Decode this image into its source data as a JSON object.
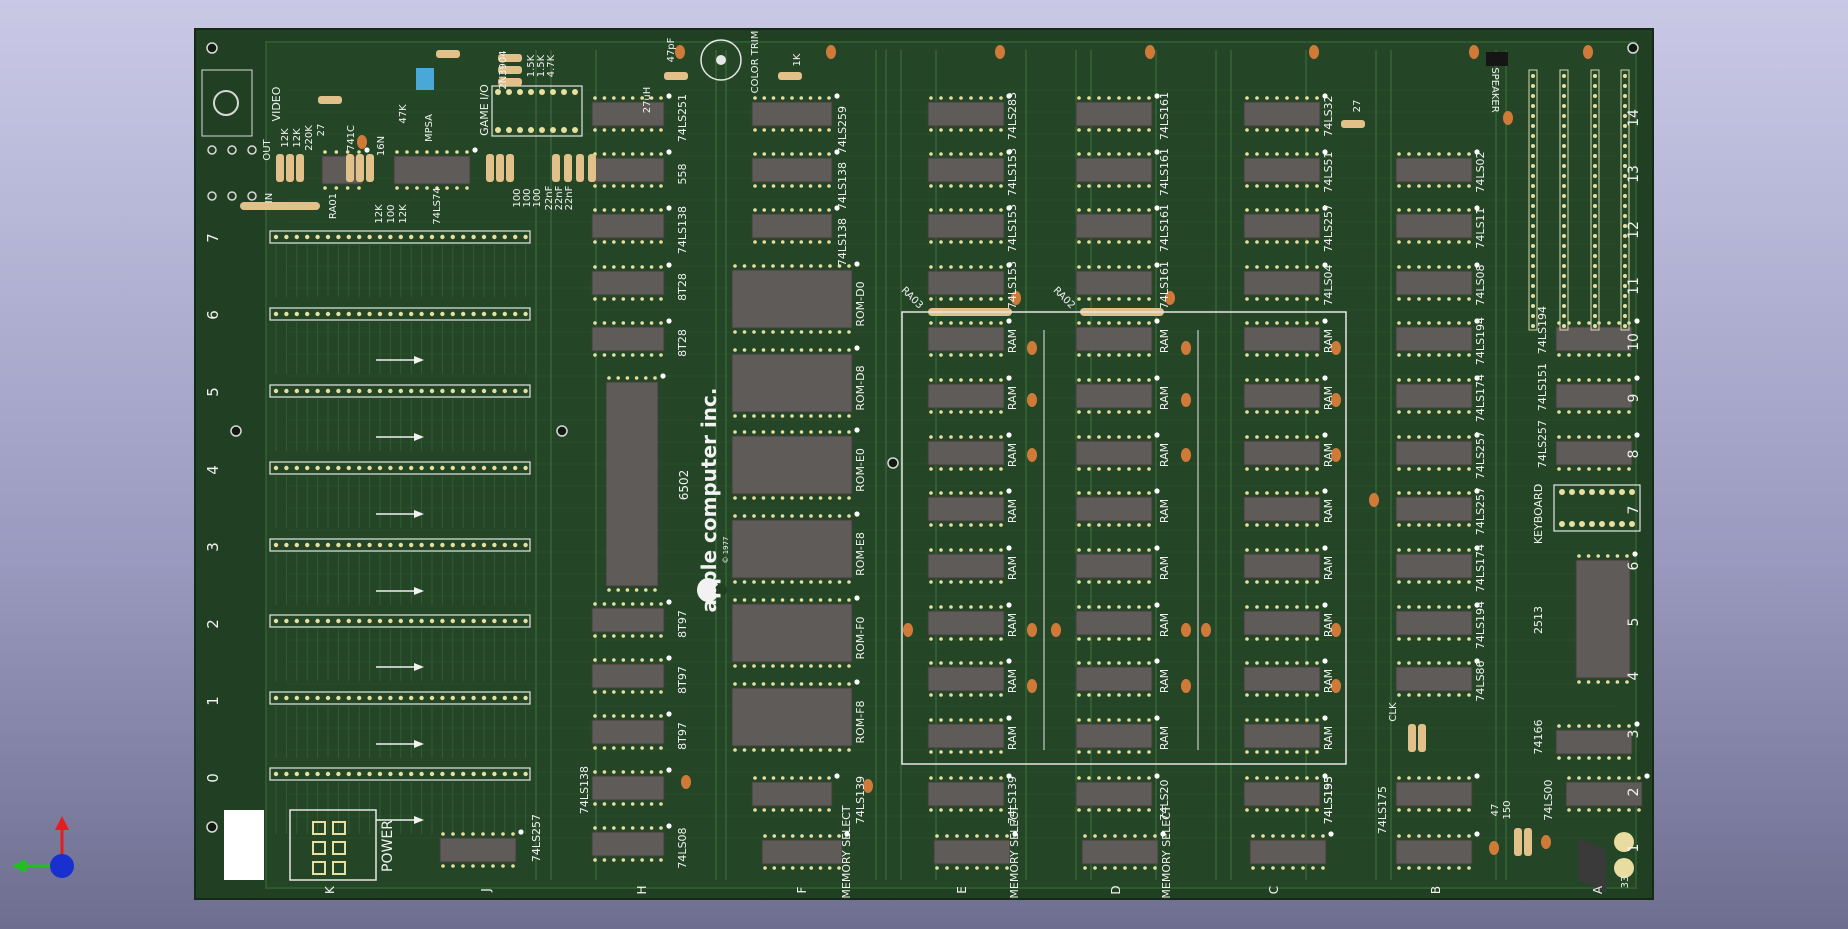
{
  "board": {
    "colors": {
      "substrate": "#213f23",
      "copper": "#2f5a30",
      "trace": "#3d6c3c",
      "chip": "#5f5b58",
      "pad": "#e8e0a0",
      "silk": "#f2f2f2",
      "cap": "#d07a3a",
      "resistor": "#e2c08a"
    },
    "brand": {
      "name": "apple computer inc.",
      "year": "© 1977"
    },
    "cpu_label": "6502",
    "rows": [
      "A",
      "B",
      "C",
      "D",
      "E",
      "F",
      "H",
      "J",
      "K"
    ],
    "slots": [
      "0",
      "1",
      "2",
      "3",
      "4",
      "5",
      "6",
      "7"
    ],
    "edge_numbers": [
      "1",
      "2",
      "3",
      "4",
      "5",
      "6",
      "7",
      "8",
      "9",
      "10",
      "11",
      "12",
      "13",
      "14"
    ],
    "connectors": {
      "video": "VIDEO",
      "out": "OUT",
      "in": "IN",
      "power": "POWER",
      "speaker": "SPEAKER",
      "keyboard": "KEYBOARD",
      "game_io": "GAME I/O",
      "color_trim": "COLOR TRIM"
    },
    "top_labels": [
      "12K",
      "12K",
      "220K",
      "27",
      "741C",
      "47K",
      "16N",
      "2N3904",
      "1.5K",
      "1.5K",
      "4.7K",
      "27uH",
      "47pF",
      "1K",
      "27",
      "MPSA",
      "RA01"
    ],
    "misc_labels": [
      "12K",
      "100",
      "12K",
      "74LS74",
      "100",
      "100",
      "100",
      "22nF",
      "22nF",
      "22nF",
      "RA03",
      "RA02",
      "47",
      "150",
      "CLK"
    ],
    "col_h": [
      "74LS251",
      "558",
      "74LS138",
      "8T28",
      "8T28",
      "8T97",
      "8T97",
      "8T97",
      "74LS138",
      "74LS08"
    ],
    "col_f": [
      "74LS259",
      "74LS138",
      "74LS138",
      "ROM-D0",
      "ROM-D8",
      "ROM-E0",
      "ROM-E8",
      "ROM-F0",
      "ROM-F8",
      "74LS139"
    ],
    "col_e": [
      "74LS283",
      "74LS153",
      "74LS153",
      "74LS153",
      "RAM",
      "RAM",
      "RAM",
      "RAM",
      "RAM",
      "RAM",
      "RAM",
      "RAM",
      "74LS139"
    ],
    "col_d": [
      "74LS161",
      "74LS161",
      "74LS161",
      "74LS161",
      "RAM",
      "RAM",
      "RAM",
      "RAM",
      "RAM",
      "RAM",
      "RAM",
      "RAM",
      "74LS20"
    ],
    "col_c": [
      "74LS32",
      "74LS51",
      "74LS257",
      "74LS04",
      "RAM",
      "RAM",
      "RAM",
      "RAM",
      "RAM",
      "RAM",
      "RAM",
      "RAM",
      "74LS195",
      "74LS153"
    ],
    "col_b": [
      "74LS02",
      "74LS11",
      "74LS08",
      "74LS194",
      "74LS174",
      "74LS257",
      "74LS257",
      "74LS174",
      "74LS194",
      "74LS86",
      "74LS175"
    ],
    "col_a": [
      "74LS194",
      "74LS151",
      "74LS257",
      "2513",
      "74166",
      "74LS00"
    ],
    "memory_select": "MEMORY SELECT",
    "j_chip": "74LS257",
    "corner_value": "33"
  }
}
